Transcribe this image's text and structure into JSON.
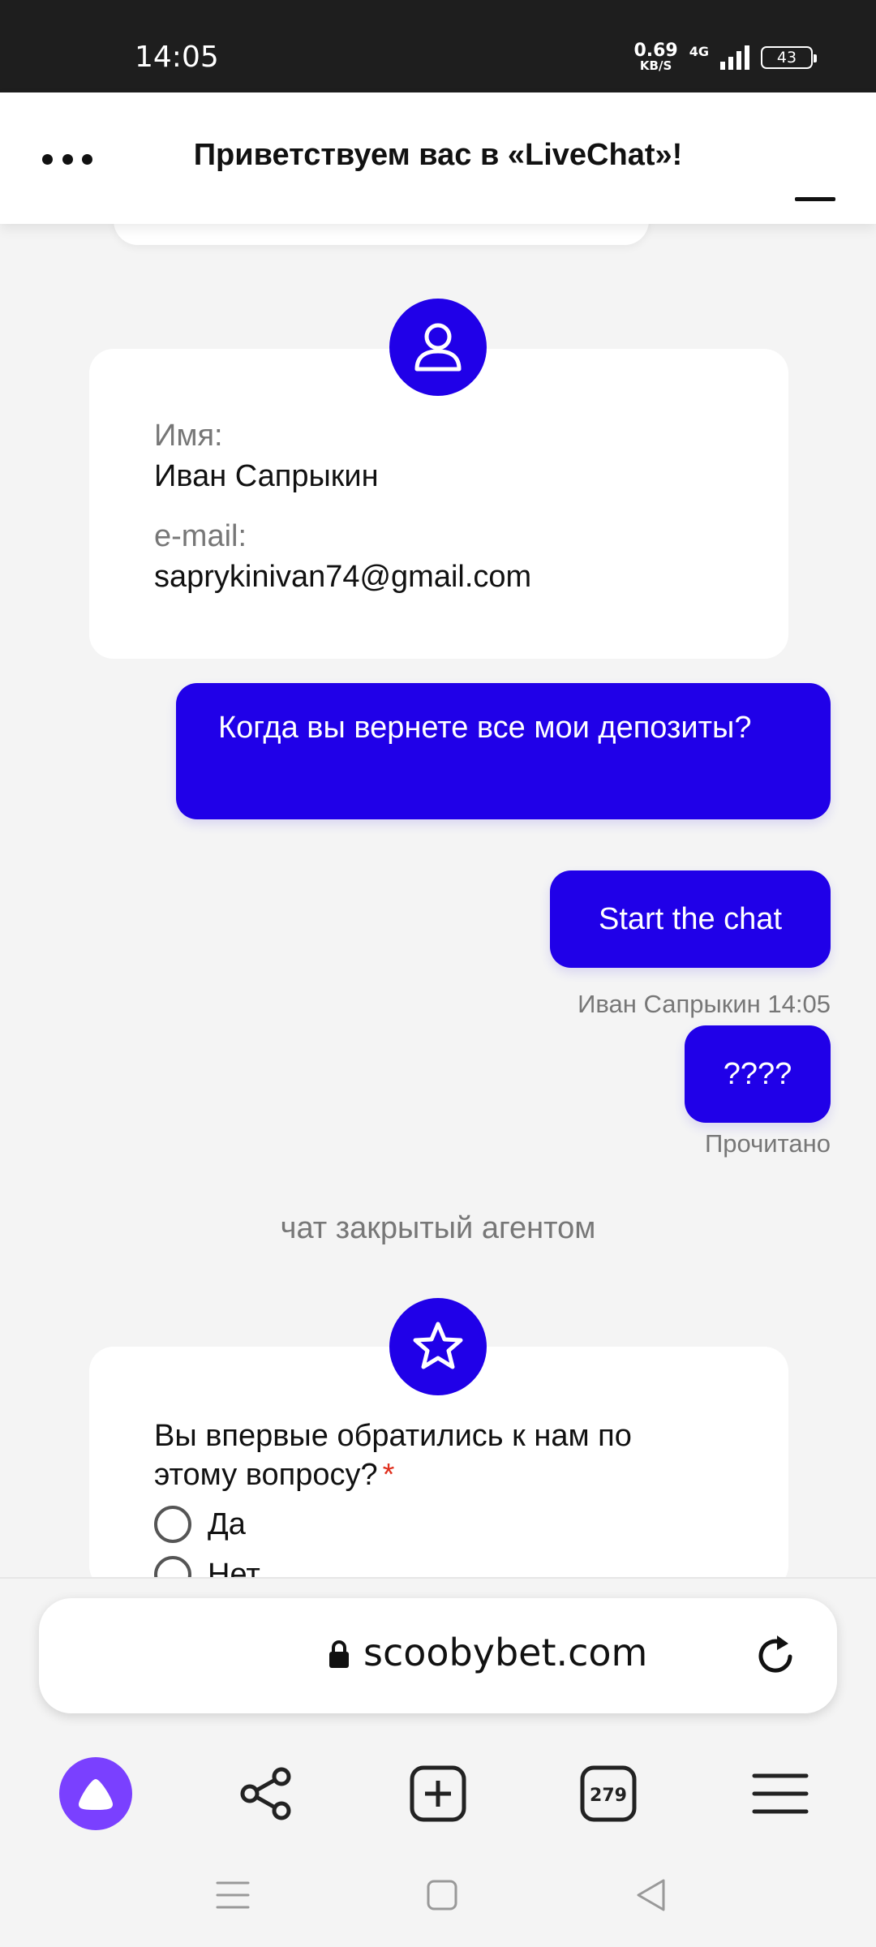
{
  "status_bar": {
    "time": "14:05",
    "speed_value": "0.69",
    "speed_unit": "KB/S",
    "network": "4G",
    "battery": "43"
  },
  "chat": {
    "title": "Приветствуем вас в «LiveChat»!",
    "user_card": {
      "name_label": "Имя:",
      "name_value": "Иван Сапрыкин",
      "email_label": "e-mail:",
      "email_value": "saprykinivan74@gmail.com"
    },
    "messages": [
      {
        "text": "Когда вы вернете все мои депозиты?"
      },
      {
        "text": "Start the chat",
        "meta": "Иван Сапрыкин 14:05"
      },
      {
        "text": "????",
        "meta": "Прочитано"
      }
    ],
    "closed_note": "чат закрытый агентом",
    "rating_card": {
      "question": "Вы впервые обратились к нам по этому вопросу?",
      "required_mark": "*",
      "options": [
        "Да",
        "Нет"
      ]
    }
  },
  "browser": {
    "url": "scoobybet.com",
    "tabs_count": "279",
    "icons": [
      "alice-icon",
      "share-icon",
      "new-tab-icon",
      "tabs-icon",
      "menu-icon"
    ]
  },
  "colors": {
    "accent": "#2000e8",
    "alice": "#7a40ff",
    "background": "#f4f4f4"
  }
}
